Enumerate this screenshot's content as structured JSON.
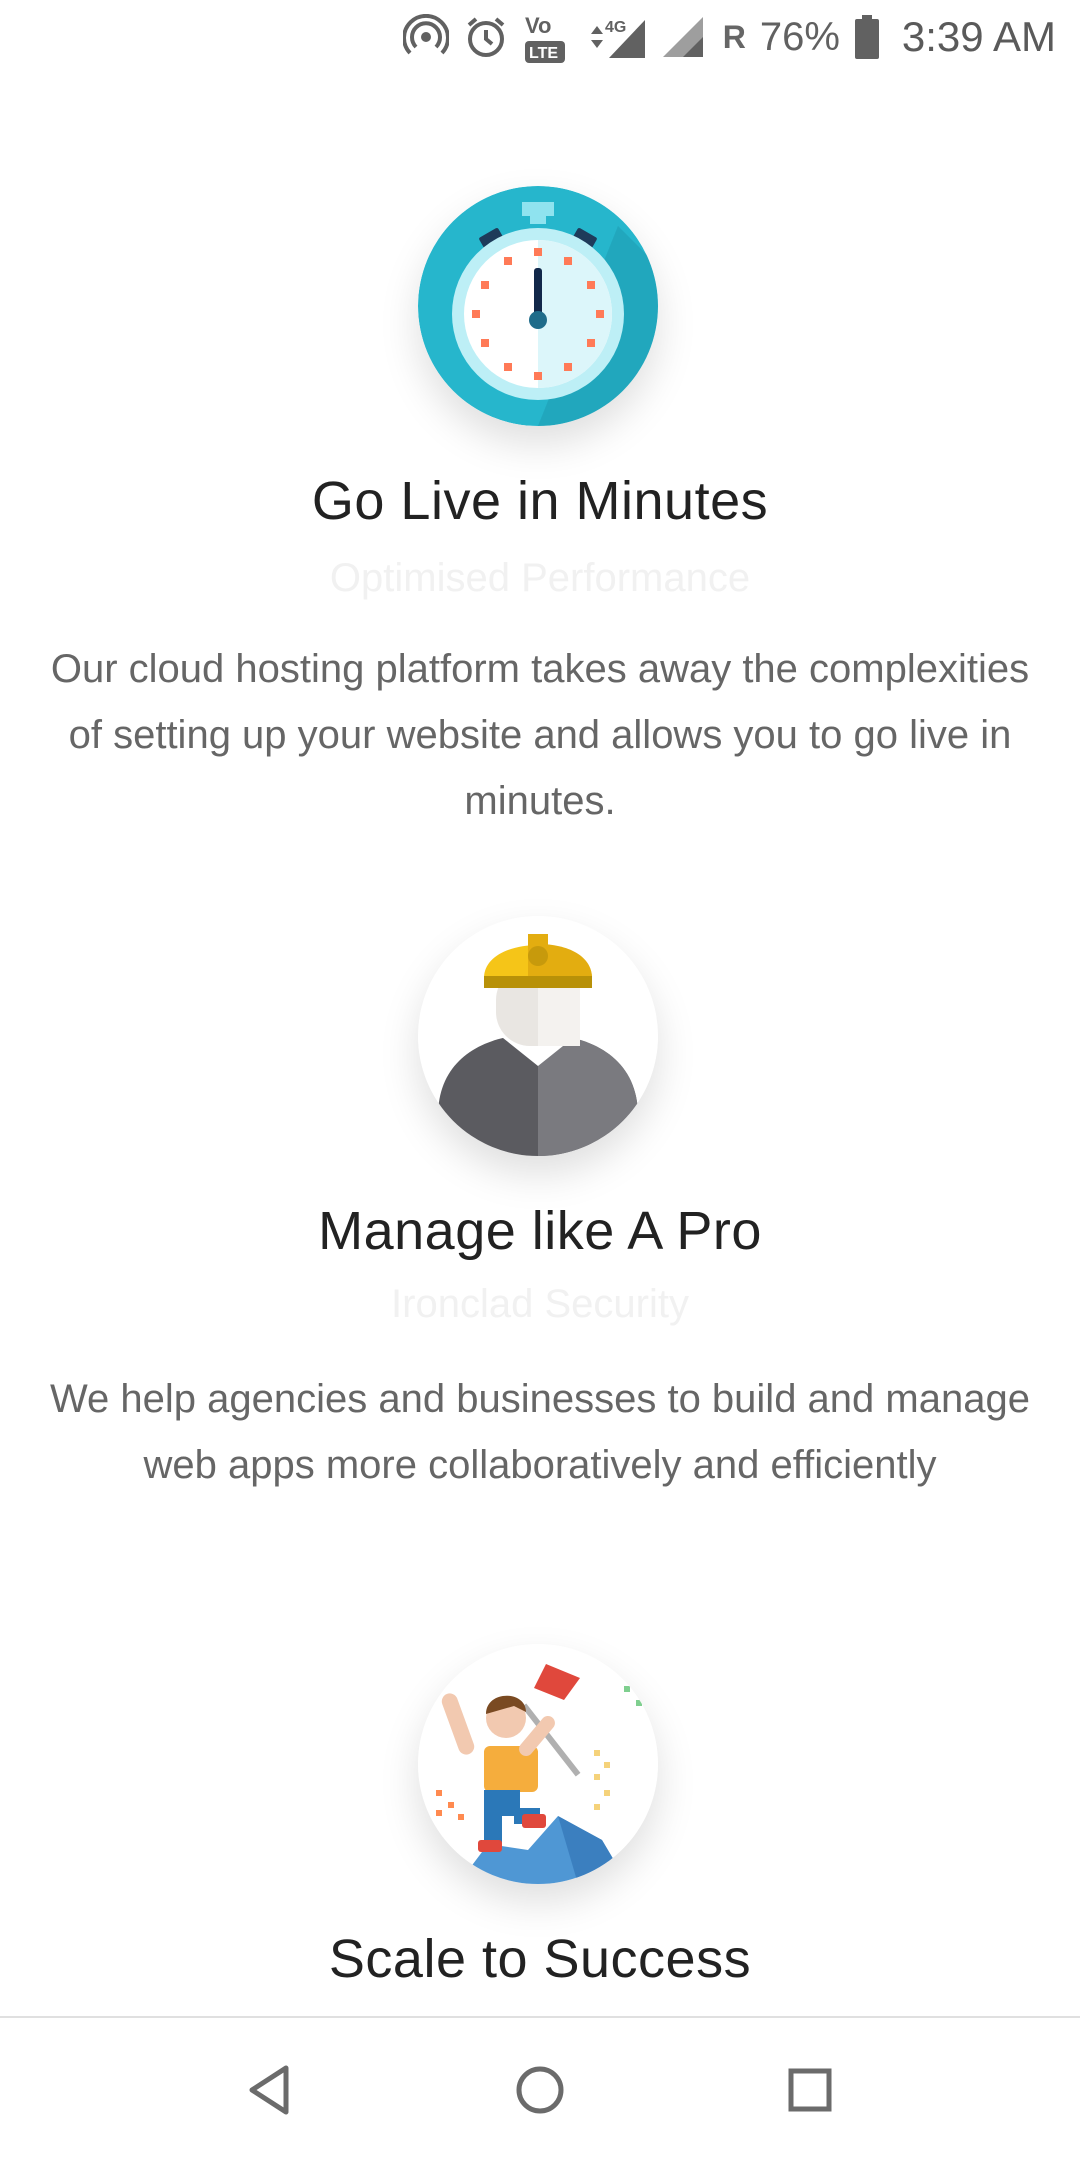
{
  "status_bar": {
    "battery": "76%",
    "time": "3:39 AM",
    "network": "4G",
    "roaming": "R",
    "volte": "LTE",
    "icons": [
      "hotspot-icon",
      "alarm-icon",
      "volte-icon",
      "signal-icon",
      "signal-icon",
      "battery-icon"
    ]
  },
  "features": [
    {
      "title": "Go Live in Minutes",
      "subtitle": "Optimised Performance",
      "description": "Our cloud hosting platform takes away the complexities of setting up your website and allows you to go live in minutes.",
      "icon": "stopwatch-icon"
    },
    {
      "title": "Manage like A Pro",
      "subtitle": "Ironclad Security",
      "description": "We help agencies and businesses to build and manage web apps more collaboratively and efficiently",
      "icon": "engineer-icon"
    },
    {
      "title": "Scale to Success",
      "icon": "summit-flag-icon"
    }
  ],
  "nav_bar": {
    "icons": [
      "back-icon",
      "home-icon",
      "recents-icon"
    ]
  },
  "colors": {
    "title": "#222222",
    "description": "#666666",
    "subtitle": "#f1f1f1",
    "stopwatch": "#26b6cc",
    "helmet": "#f5c518"
  }
}
